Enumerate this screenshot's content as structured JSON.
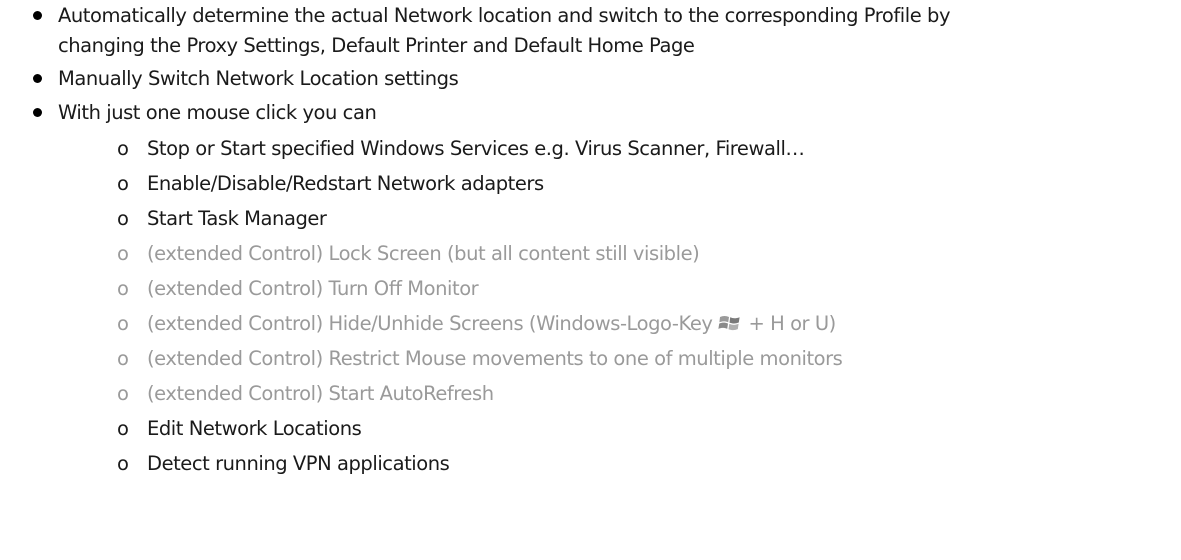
{
  "bullets": [
    {
      "line1": "Automatically determine the actual Network location and switch to the corresponding Profile by",
      "line2": "changing the Proxy Settings, Default Printer and Default Home Page"
    },
    {
      "text": "Manually Switch Network Location settings"
    },
    {
      "text": "With just one mouse click you can"
    }
  ],
  "sub_marker": "o",
  "sub_items": [
    {
      "text": "Stop or Start specified Windows Services e.g. Virus Scanner, Firewall…",
      "dim": false
    },
    {
      "text": "Enable/Disable/Redstart Network adapters",
      "dim": false
    },
    {
      "text": "Start Task Manager",
      "dim": false
    },
    {
      "text": "(extended Control) Lock Screen (but all content still visible)",
      "dim": true
    },
    {
      "text": "(extended Control) Turn Off  Monitor",
      "dim": true
    },
    {
      "text_before": "(extended Control) Hide/Unhide Screens (Windows-Logo-Key",
      "text_after": "+  H or U)",
      "dim": true
    },
    {
      "text": "(extended Control) Restrict Mouse movements to one of multiple monitors",
      "dim": true
    },
    {
      "text": "(extended Control) Start AutoRefresh",
      "dim": true
    },
    {
      "text": "Edit Network Locations",
      "dim": false
    },
    {
      "text": "Detect  running VPN applications",
      "dim": false
    }
  ],
  "icons": {
    "windows_key": "windows-logo-icon"
  }
}
